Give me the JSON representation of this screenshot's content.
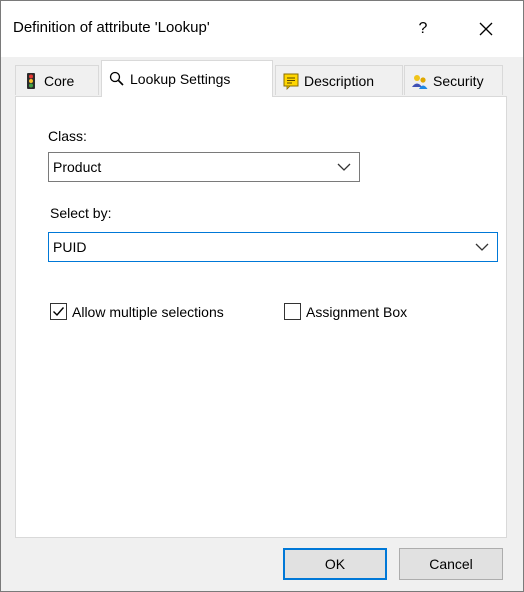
{
  "window": {
    "title": "Definition of attribute 'Lookup'",
    "help_label": "?"
  },
  "tabs": [
    {
      "label": "Core",
      "icon": "traffic-light-icon"
    },
    {
      "label": "Lookup Settings",
      "icon": "magnifier-icon"
    },
    {
      "label": "Description",
      "icon": "note-icon"
    },
    {
      "label": "Security",
      "icon": "users-key-icon"
    }
  ],
  "form": {
    "class_label": "Class:",
    "class_value": "Product",
    "select_by_label": "Select by:",
    "select_by_value": "PUID",
    "allow_multiple_label": "Allow multiple selections",
    "allow_multiple_checked": true,
    "assignment_box_label": "Assignment Box",
    "assignment_box_checked": false
  },
  "buttons": {
    "ok": "OK",
    "cancel": "Cancel"
  },
  "colors": {
    "accent": "#0078d7",
    "background": "#f0f0f0"
  }
}
